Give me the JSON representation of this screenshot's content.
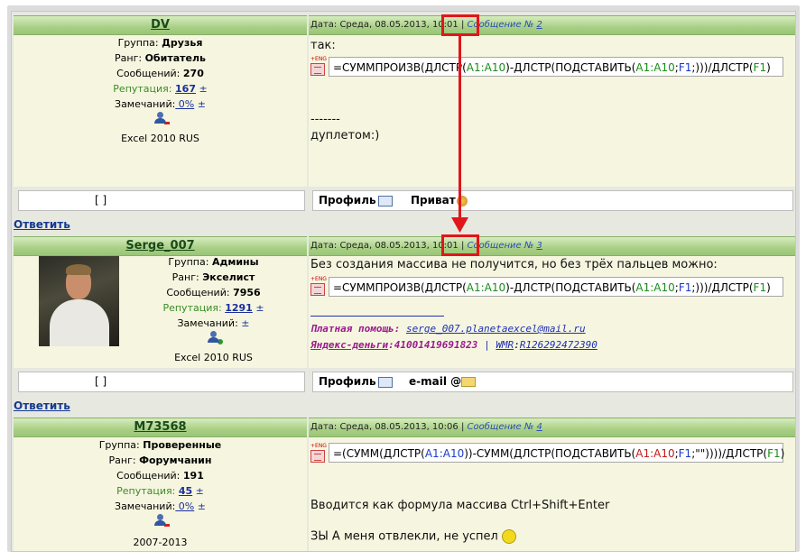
{
  "posts": [
    {
      "username": "DV",
      "group_label": "Группа:",
      "group": "Друзья",
      "rank_label": "Ранг:",
      "rank": "Обитатель",
      "messages_label": "Сообщений:",
      "messages": "270",
      "rep_label": "Репутация:",
      "rep": "167",
      "pm_sign": "±",
      "warn_label": "Замечаний:",
      "warn": " 0%",
      "extra": "Excel 2010 RUS",
      "date_label": "Дата: Среда, 08.05.2013,",
      "time": "10:01",
      "sep": "|",
      "msg_label": "Сообщение №",
      "msg_num": "2",
      "text1": "так:",
      "formula": {
        "p1": "=СУММПРОИЗВ(ДЛСТР(",
        "r1": "A1:A10",
        "p2": ")-ДЛСТР(ПОДСТАВИТЬ(",
        "r2": "A1:A10",
        "p3": ";",
        "r3": "F1",
        "p4": ";)))/ДЛСТР(",
        "r4": "F1",
        "p5": ")"
      },
      "text2": "-------",
      "text3": "дуплетом:)",
      "box": "[                        ]",
      "profile": "Профиль",
      "private": "Приват"
    },
    {
      "username": "Serge_007",
      "group_label": "Группа:",
      "group": "Админы",
      "rank_label": "Ранг:",
      "rank": "Экселист",
      "messages_label": "Сообщений:",
      "messages": "7956",
      "rep_label": "Репутация:",
      "rep": "1291",
      "pm_sign": "±",
      "warn_label": "Замечаний:",
      "warn": "",
      "extra": "Excel 2010 RUS",
      "date_label": "Дата: Среда, 08.05.2013,",
      "time": "10:01",
      "sep": "|",
      "msg_label": "Сообщение №",
      "msg_num": "3",
      "text1": "Без создания массива не получится, но без трёх пальцев можно:",
      "formula": {
        "p1": "=СУММПРОИЗВ(ДЛСТР(",
        "r1": "A1:A10",
        "p2": ")-ДЛСТР(ПОДСТАВИТЬ(",
        "r2": "A1:A10",
        "p3": ";",
        "r3": "F1",
        "p4": ";)))/ДЛСТР(",
        "r4": "F1",
        "p5": ")"
      },
      "sig_paid_label": "Платная помощь:",
      "sig_paid": "serge_007.planetaexcel@mail.ru",
      "sig_yandex_label": "Яндекс-деньги",
      "sig_yandex": ":41001419691823",
      "sig_sep": "|",
      "sig_wmr_label": "WMR",
      "sig_wmr": "R126292472390",
      "box": "[                        ]",
      "profile": "Профиль",
      "email": "e-mail",
      "at": "@"
    },
    {
      "username": "M73568",
      "group_label": "Группа:",
      "group": "Проверенные",
      "rank_label": "Ранг:",
      "rank": "Форумчанин",
      "messages_label": "Сообщений:",
      "messages": "191",
      "rep_label": "Репутация:",
      "rep": "45",
      "pm_sign": "±",
      "warn_label": "Замечаний:",
      "warn": " 0%",
      "extra": "2007-2013",
      "date_label": "Дата: Среда, 08.05.2013, 10:06",
      "sep": "|",
      "msg_label": "Сообщение №",
      "msg_num": "4",
      "formula": {
        "p1": "=(СУММ(ДЛСТР(",
        "r1": "A1:A10",
        "p2": "))-СУММ(ДЛСТР(ПОДСТАВИТЬ(",
        "r2": "A1:A10",
        "p3": ";",
        "r3": "F1",
        "p4": ";\"\"))))/ДЛСТР(",
        "r4": "F1",
        "p5": ")"
      },
      "text1": "Вводится как формула массива Ctrl+Shift+Enter",
      "text2": "ЗЫ А меня отвлекли, не успел"
    }
  ],
  "reply": "Ответить",
  "fx_label": "+ENG",
  "colors": {
    "highlight": "#e0161b",
    "header_green": "#a9d085",
    "ref_green": "#1c8c1c",
    "ref_blue": "#1c3ac8"
  }
}
